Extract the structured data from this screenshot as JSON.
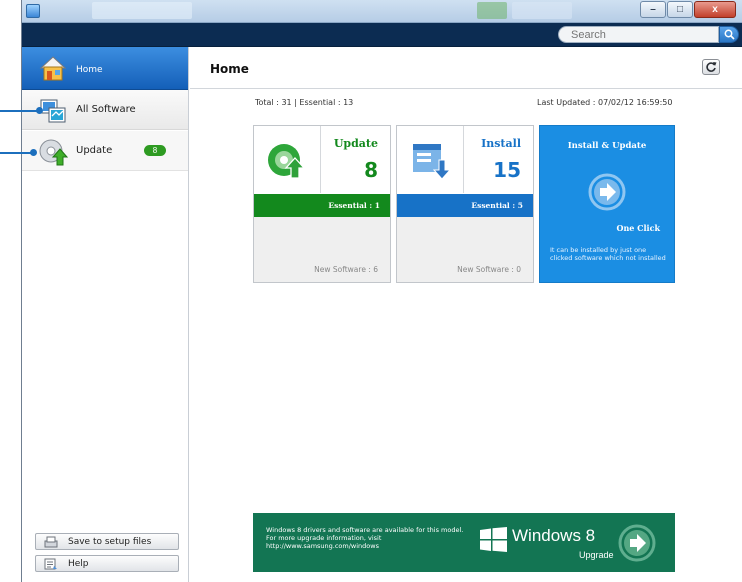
{
  "window": {
    "minimize_glyph": "–",
    "maximize_glyph": "□",
    "close_glyph": "x"
  },
  "search": {
    "placeholder": "Search"
  },
  "sidebar": {
    "items": [
      {
        "label": "Home",
        "icon": "home-icon",
        "selected": true
      },
      {
        "label": "All Software",
        "icon": "all-software-icon"
      },
      {
        "label": "Update",
        "icon": "update-icon",
        "badge": "8"
      }
    ],
    "footer": [
      {
        "label": "Save to setup files",
        "icon": "save-icon"
      },
      {
        "label": "Help",
        "icon": "help-icon"
      }
    ]
  },
  "main": {
    "title": "Home",
    "summary": "Total : 31 | Essential : 13",
    "last_updated": "Last Updated : 07/02/12 16:59:50",
    "cards": [
      {
        "title": "Update",
        "count": "8",
        "essential": "Essential : 1",
        "new_software": "New Software : 6",
        "color": "#13891d"
      },
      {
        "title": "Install",
        "count": "15",
        "essential": "Essential : 5",
        "new_software": "New Software : 0",
        "color": "#1772c7"
      }
    ],
    "install_update": {
      "title": "Install & Update",
      "one_click": "One Click",
      "description": "It can be installed by just one clicked software which not installed",
      "color": "#1b8ee3"
    },
    "banner": {
      "text": "Windows 8 drivers and software are available for this model. For more upgrade information, visit http://www.samsung.com/windows",
      "brand": "Windows 8",
      "sub": "Upgrade",
      "color": "#137553"
    }
  },
  "colors": {
    "accent": "#1c6fbd",
    "topbar": "#0c2c52",
    "nav_selected": "#2a78d0"
  }
}
